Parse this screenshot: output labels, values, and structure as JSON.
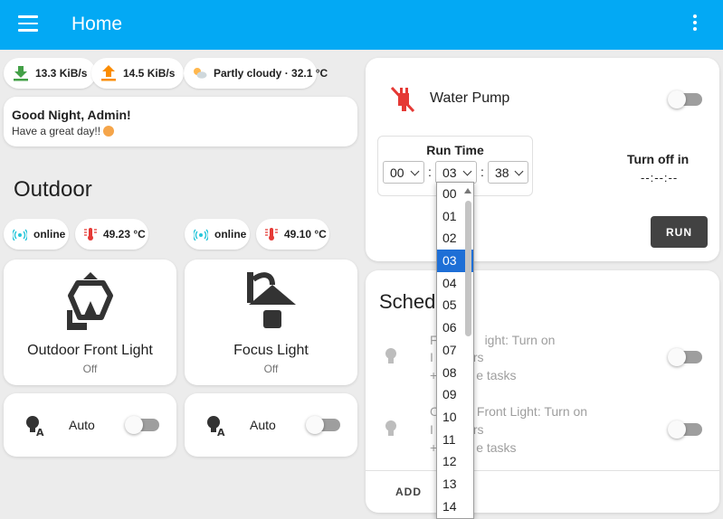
{
  "header": {
    "title": "Home"
  },
  "chips": {
    "download": "13.3 KiB/s",
    "upload": "14.5 KiB/s",
    "weather": "Partly cloudy · 32.1 °C",
    "status_1": "online",
    "temp_1": "49.23 °C",
    "status_2": "online",
    "temp_2": "49.10 °C"
  },
  "greeting": {
    "title": "Good Night, Admin!",
    "subtitle": "Have a great day!!"
  },
  "outdoor": {
    "title": "Outdoor",
    "lights": [
      {
        "name": "Outdoor Front Light",
        "state": "Off"
      },
      {
        "name": "Focus Light",
        "state": "Off"
      }
    ],
    "auto": [
      {
        "label": "Auto"
      },
      {
        "label": "Auto"
      }
    ]
  },
  "pump": {
    "name": "Water Pump",
    "run_time_title": "Run Time",
    "hours": "00",
    "minutes": "03",
    "seconds": "38",
    "separator": ":",
    "turn_off_title": "Turn off in",
    "turn_off_value": "--:--:--",
    "run_label": "RUN"
  },
  "schedule": {
    "title": "Sched",
    "items": [
      {
        "line1": "ight: Turn on",
        "line1_prefix": "F",
        "line2": "rs",
        "line2_prefix": "I",
        "line3": "e tasks",
        "line3_prefix": "+"
      },
      {
        "line1": "Front Light: Turn on",
        "line1_prefix": "O",
        "line2": "rs",
        "line2_prefix": "I",
        "line3": "e tasks",
        "line3_prefix": "+"
      }
    ],
    "add_label": "ADD"
  },
  "dropdown": {
    "options": [
      "00",
      "01",
      "02",
      "03",
      "04",
      "05",
      "06",
      "07",
      "08",
      "09",
      "10",
      "11",
      "12",
      "13",
      "14"
    ],
    "selected": "03"
  },
  "colors": {
    "header": "#03a9f4",
    "download_icon": "#43a047",
    "upload_icon": "#fb8c00",
    "pump_icon": "#e53935",
    "status_icon": "#26c6da",
    "temp_icon": "#e53935",
    "selected": "#1e6fd6"
  }
}
